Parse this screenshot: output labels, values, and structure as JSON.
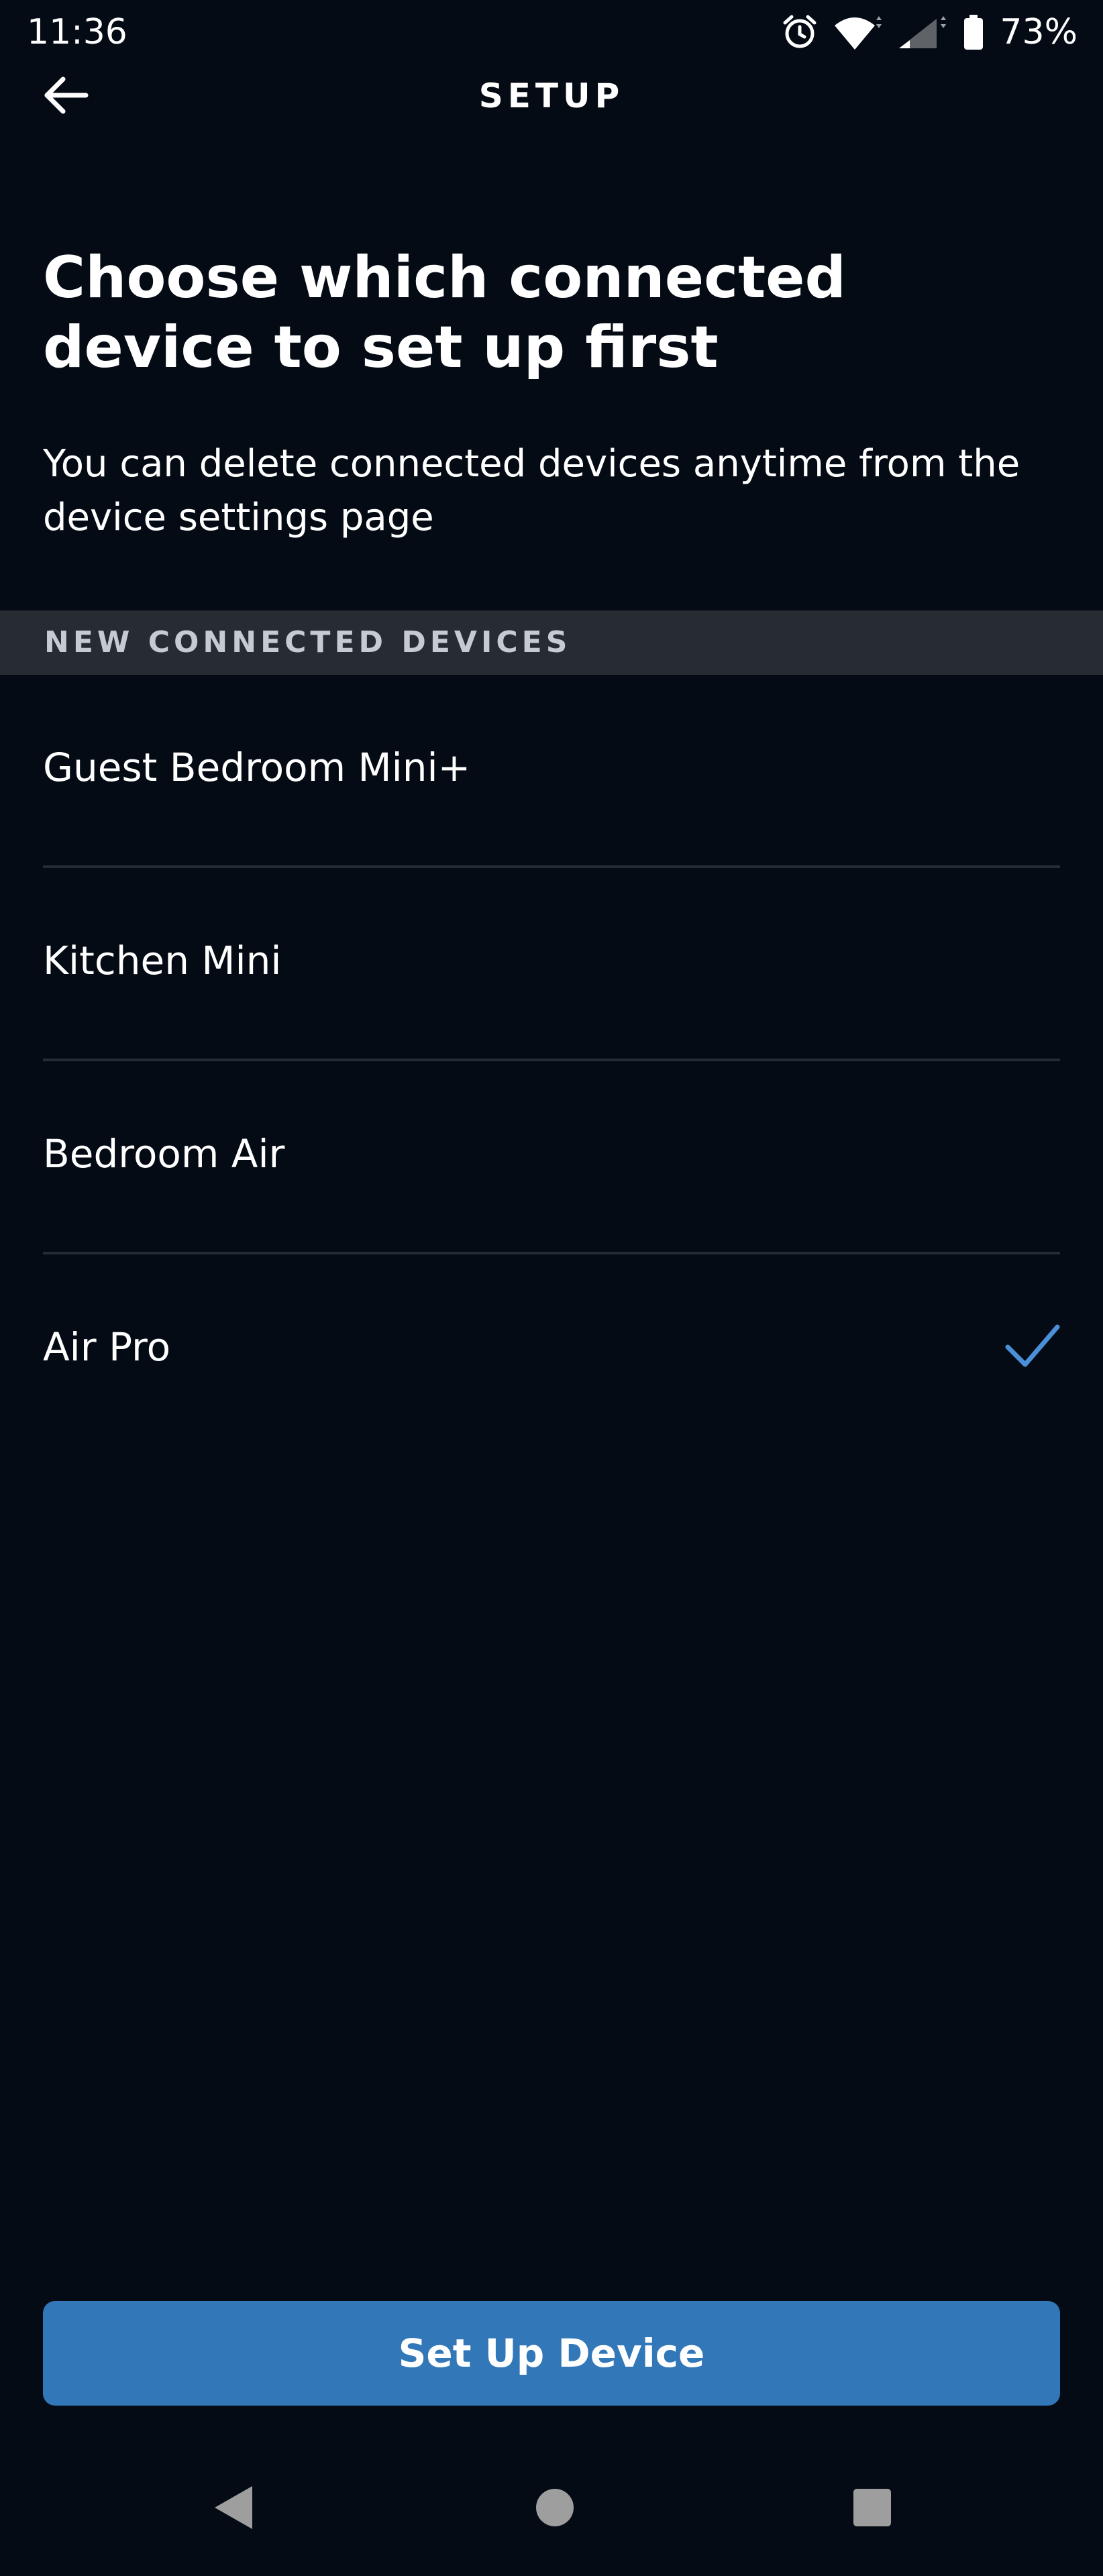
{
  "status_bar": {
    "time": "11:36",
    "battery_text": "73%",
    "icons": [
      "alarm-icon",
      "wifi-icon",
      "signal-icon",
      "battery-icon"
    ]
  },
  "app_bar": {
    "title": "SETUP",
    "back_icon": "arrow-left-icon"
  },
  "main": {
    "heading": "Choose which connected device to set up first",
    "subtitle": "You can delete connected devices anytime from the device settings page",
    "section_header": "NEW CONNECTED DEVICES",
    "devices": [
      {
        "label": "Guest Bedroom Mini+",
        "selected": false
      },
      {
        "label": "Kitchen Mini",
        "selected": false
      },
      {
        "label": "Bedroom Air",
        "selected": false
      },
      {
        "label": "Air Pro",
        "selected": true
      }
    ],
    "primary_button": "Set Up Device"
  },
  "nav_bar": {
    "icons": [
      "nav-back-icon",
      "nav-home-icon",
      "nav-recents-icon"
    ]
  },
  "colors": {
    "background": "#040b14",
    "section_header_bg": "#272c33",
    "accent": "#3277b7",
    "check": "#4a90d9",
    "divider": "#262c35"
  }
}
